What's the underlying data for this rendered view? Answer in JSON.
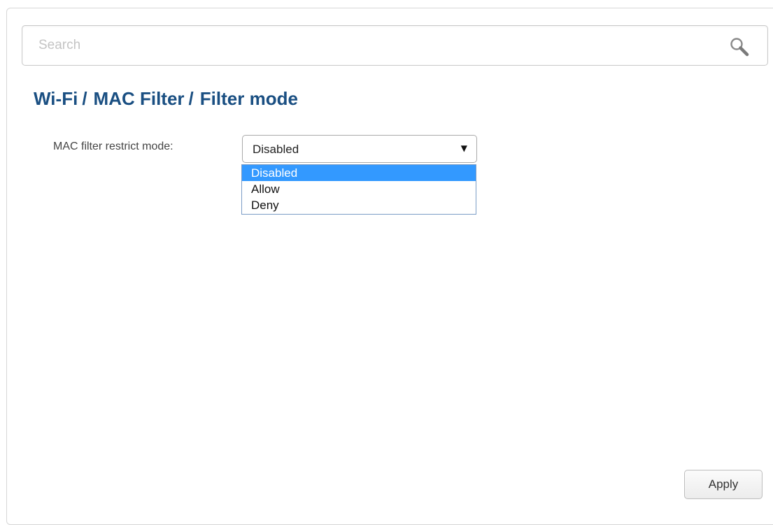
{
  "search": {
    "placeholder": "Search",
    "value": "",
    "icon": "search-icon"
  },
  "breadcrumb": {
    "items": [
      "Wi-Fi",
      "MAC Filter",
      "Filter mode"
    ],
    "separator": "/"
  },
  "form": {
    "restrict_mode": {
      "label": "MAC filter restrict mode:",
      "selected": "Disabled",
      "options": [
        "Disabled",
        "Allow",
        "Deny"
      ],
      "highlighted_option": "Disabled"
    }
  },
  "actions": {
    "apply_label": "Apply"
  },
  "colors": {
    "breadcrumb": "#1a4f82",
    "option_highlight": "#3399ff"
  }
}
